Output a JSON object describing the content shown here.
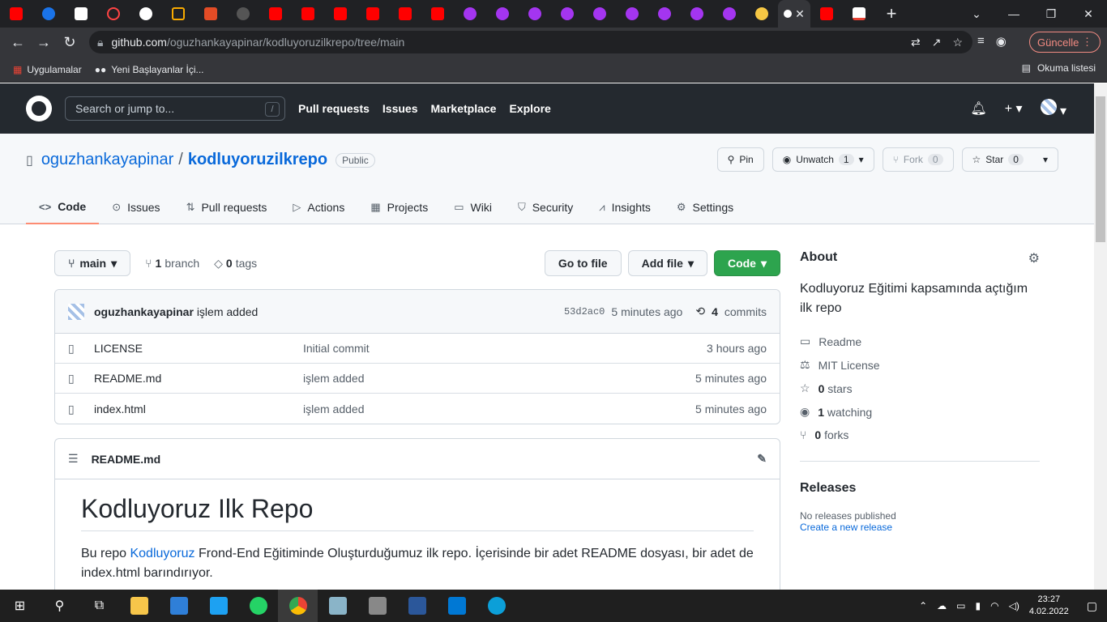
{
  "browser": {
    "url_host": "github.com",
    "url_path": "/oguzhankayapinar/kodluyoruzilkrepo/tree/main",
    "update_label": "Güncelle",
    "bookmarks": [
      "Uygulamalar",
      "Yeni Başlayanlar İçi..."
    ],
    "reading_list": "Okuma listesi"
  },
  "gh": {
    "search_placeholder": "Search or jump to...",
    "search_key": "/",
    "nav": [
      "Pull requests",
      "Issues",
      "Marketplace",
      "Explore"
    ]
  },
  "repo": {
    "owner": "oguzhankayapinar",
    "name": "kodluyoruzilkrepo",
    "visibility": "Public",
    "actions": {
      "pin": "Pin",
      "unwatch": "Unwatch",
      "unwatch_count": "1",
      "fork": "Fork",
      "fork_count": "0",
      "star": "Star",
      "star_count": "0"
    },
    "tabs": [
      "Code",
      "Issues",
      "Pull requests",
      "Actions",
      "Projects",
      "Wiki",
      "Security",
      "Insights",
      "Settings"
    ]
  },
  "code": {
    "branch": "main",
    "branch_count": "1",
    "branch_label": "branch",
    "tag_count": "0",
    "tag_label": "tags",
    "goto": "Go to file",
    "addfile": "Add file",
    "code": "Code",
    "commit": {
      "author": "oguzhankayapinar",
      "message": "işlem added",
      "sha": "53d2ac0",
      "age": "5 minutes ago",
      "count": "4",
      "count_label": "commits"
    },
    "files": [
      {
        "name": "LICENSE",
        "msg": "Initial commit",
        "age": "3 hours ago"
      },
      {
        "name": "README.md",
        "msg": "işlem added",
        "age": "5 minutes ago"
      },
      {
        "name": "index.html",
        "msg": "işlem added",
        "age": "5 minutes ago"
      }
    ]
  },
  "readme": {
    "file": "README.md",
    "title": "Kodluyoruz Ilk Repo",
    "p_pre": "Bu repo ",
    "p_link": "Kodluyoruz",
    "p_post": " Frond-End Eğitiminde Oluşturduğumuz ilk repo. İçerisinde bir adet README dosyası, bir adet de index.html barındırıyor."
  },
  "about": {
    "title": "About",
    "desc": "Kodluyoruz Eğitimi kapsamında açtığım ilk repo",
    "readme": "Readme",
    "license": "MIT License",
    "stars": "0",
    "stars_label": "stars",
    "watching": "1",
    "watching_label": "watching",
    "forks": "0",
    "forks_label": "forks",
    "releases_title": "Releases",
    "no_releases": "No releases published",
    "create_release": "Create a new release"
  },
  "taskbar": {
    "time": "23:27",
    "date": "4.02.2022"
  }
}
